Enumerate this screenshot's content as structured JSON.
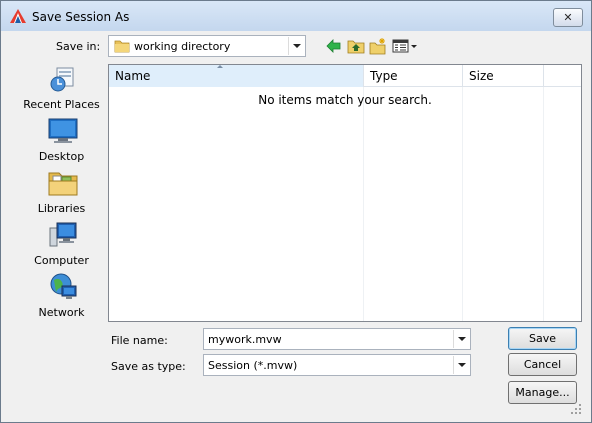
{
  "window": {
    "title": "Save Session As",
    "close_glyph": "✕"
  },
  "toolbar": {
    "save_in_label": "Save in:",
    "save_in_value": "working directory",
    "icons": [
      "back-arrow-icon",
      "up-folder-icon",
      "new-folder-icon",
      "view-menu-icon"
    ]
  },
  "places": [
    {
      "label": "Recent Places",
      "icon": "recent-places-icon"
    },
    {
      "label": "Desktop",
      "icon": "desktop-icon"
    },
    {
      "label": "Libraries",
      "icon": "libraries-icon"
    },
    {
      "label": "Computer",
      "icon": "computer-icon"
    },
    {
      "label": "Network",
      "icon": "network-icon"
    }
  ],
  "file_list": {
    "columns": [
      "Name",
      "Type",
      "Size"
    ],
    "sorted_column": "Name",
    "empty_message": "No items match your search."
  },
  "form": {
    "file_name_label": "File name:",
    "file_name_value": "mywork.mvw",
    "save_type_label": "Save as type:",
    "save_type_value": "Session (*.mvw)"
  },
  "buttons": {
    "save": "Save",
    "cancel": "Cancel",
    "manage": "Manage..."
  },
  "colors": {
    "titlebar": "#c4d7ee",
    "dialog_bg": "#f0f0f0",
    "selected_column": "#dfeefb",
    "default_button_border": "#3c7fb1"
  }
}
